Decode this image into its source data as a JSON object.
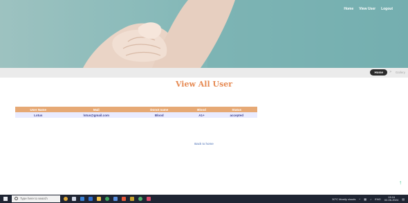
{
  "top_nav": {
    "home": "Home",
    "view_user": "View User",
    "logout": "Logout"
  },
  "breadcrumb": {
    "home": "Home",
    "separator": ">",
    "current": "Gallery"
  },
  "page_title": "View All User",
  "table": {
    "headers": [
      "User Name",
      "Mail",
      "Donot name",
      "Blood",
      "Status"
    ],
    "rows": [
      [
        "Lotus",
        "lotus@gmail.com",
        "Blood",
        "A1+",
        "accepted"
      ]
    ]
  },
  "back_link": "Back to home",
  "taskbar": {
    "search_placeholder": "Type here to search",
    "weather": "30°C Mostly clouds",
    "lang": "ENG",
    "time": "13:16",
    "date": "02-06-2024"
  },
  "colors": {
    "accent": "#e68a53",
    "table_header": "#e6a975",
    "row_bg": "#e9ebff",
    "link": "#4a6fb5",
    "scroll_arrow": "#35c08a"
  }
}
